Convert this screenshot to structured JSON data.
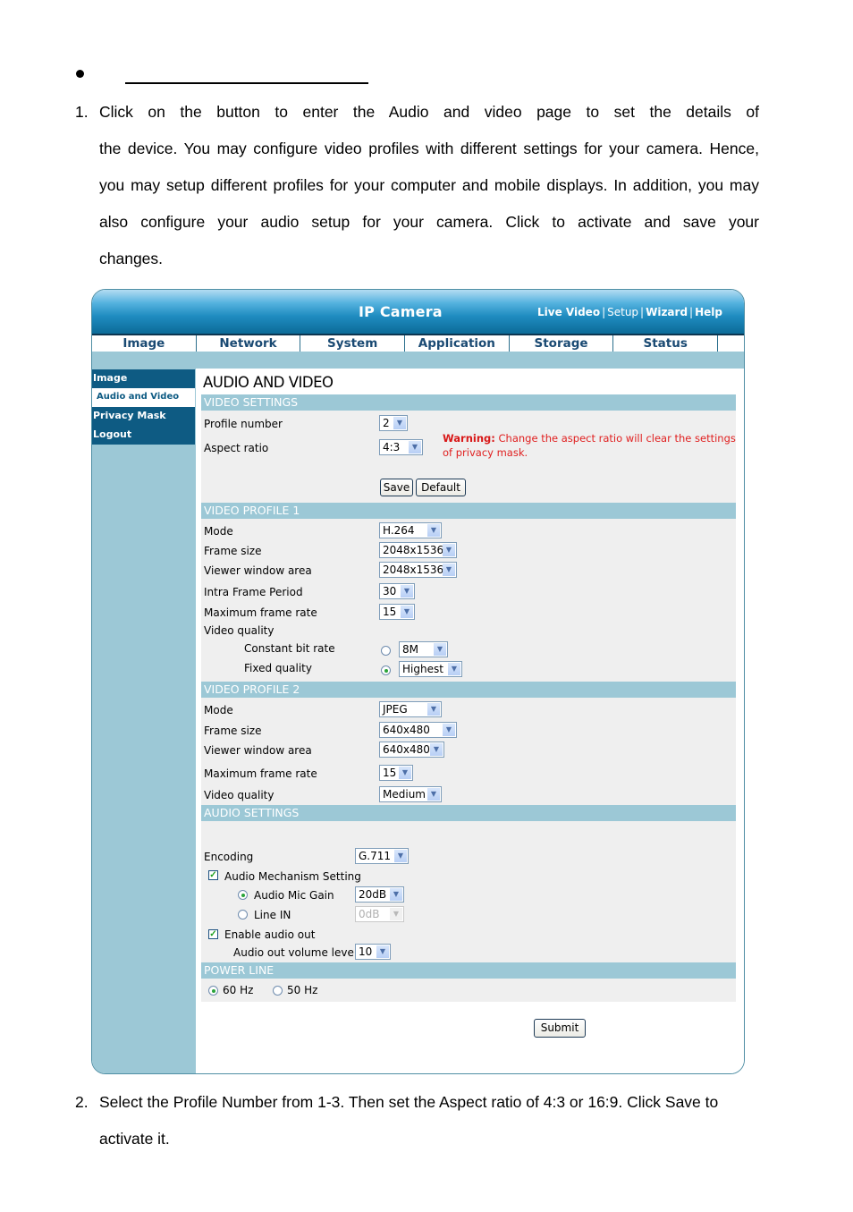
{
  "doc": {
    "p1_num": "1.",
    "p1_lines": [
      "Click on the                          button to enter the Audio and video page to set the details of",
      "the device. You may configure video profiles with different settings for your camera. Hence,",
      "you may setup different profiles for your computer and mobile displays. In addition, you may",
      "also configure your audio setup for your camera. Click            to activate and save your",
      "changes."
    ],
    "p2_num": "2.",
    "p2_lines": [
      "Select the Profile Number from 1-3. Then set the Aspect ratio of 4:3 or 16:9. Click Save to",
      "activate it."
    ]
  },
  "app": {
    "title": "IP Camera",
    "top_links": [
      "Live Video",
      "Setup",
      "Wizard",
      "Help"
    ],
    "separator": "|"
  },
  "tabs": [
    "Image",
    "Network",
    "System",
    "Application",
    "Storage",
    "Status"
  ],
  "sidebar": {
    "items": [
      {
        "label": "Image",
        "active": false
      },
      {
        "label": "Audio and Video",
        "active": true
      },
      {
        "label": "Privacy Mask",
        "active": false
      },
      {
        "label": "Logout",
        "active": false
      }
    ]
  },
  "page": {
    "title": "AUDIO AND VIDEO",
    "video_settings": {
      "header": "VIDEO SETTINGS",
      "profile_number_label": "Profile number",
      "profile_number_value": "2",
      "aspect_ratio_label": "Aspect ratio",
      "aspect_ratio_value": "4:3",
      "warning_prefix": "Warning:",
      "warning_text": " Change the aspect ratio will clear the settings of privacy mask.",
      "save_label": "Save",
      "default_label": "Default"
    },
    "profile1": {
      "header": "VIDEO PROFILE 1",
      "mode_label": "Mode",
      "mode_value": "H.264",
      "frame_size_label": "Frame size",
      "frame_size_value": "2048x1536",
      "viewer_label": "Viewer window area",
      "viewer_value": "2048x1536",
      "intra_label": "Intra Frame Period",
      "intra_value": "30",
      "max_fps_label": "Maximum frame rate",
      "max_fps_value": "15",
      "quality_label": "Video quality",
      "cbr_label": "Constant bit rate",
      "cbr_value": "8M",
      "cbr_selected": false,
      "fixed_label": "Fixed quality",
      "fixed_value": "Highest",
      "fixed_selected": true
    },
    "profile2": {
      "header": "VIDEO PROFILE 2",
      "mode_label": "Mode",
      "mode_value": "JPEG",
      "frame_size_label": "Frame size",
      "frame_size_value": "640x480",
      "viewer_label": "Viewer window area",
      "viewer_value": "640x480",
      "max_fps_label": "Maximum frame rate",
      "max_fps_value": "15",
      "quality_label": "Video quality",
      "quality_value": "Medium"
    },
    "audio": {
      "header": "AUDIO SETTINGS",
      "encoding_label": "Encoding",
      "encoding_value": "G.711",
      "mechanism_label": "Audio Mechanism Setting",
      "mechanism_checked": true,
      "mic_gain_label": "Audio Mic Gain",
      "mic_gain_value": "20dB",
      "mic_gain_selected": true,
      "line_in_label": "Line IN",
      "line_in_value": "0dB",
      "line_in_selected": false,
      "audio_out_label": "Enable audio out",
      "audio_out_checked": true,
      "volume_label": "Audio out volume level",
      "volume_value": "10"
    },
    "power_line": {
      "header": "POWER LINE",
      "opt_60": "60 Hz",
      "opt_60_selected": true,
      "opt_50": "50 Hz",
      "opt_50_selected": false
    },
    "submit_label": "Submit"
  }
}
